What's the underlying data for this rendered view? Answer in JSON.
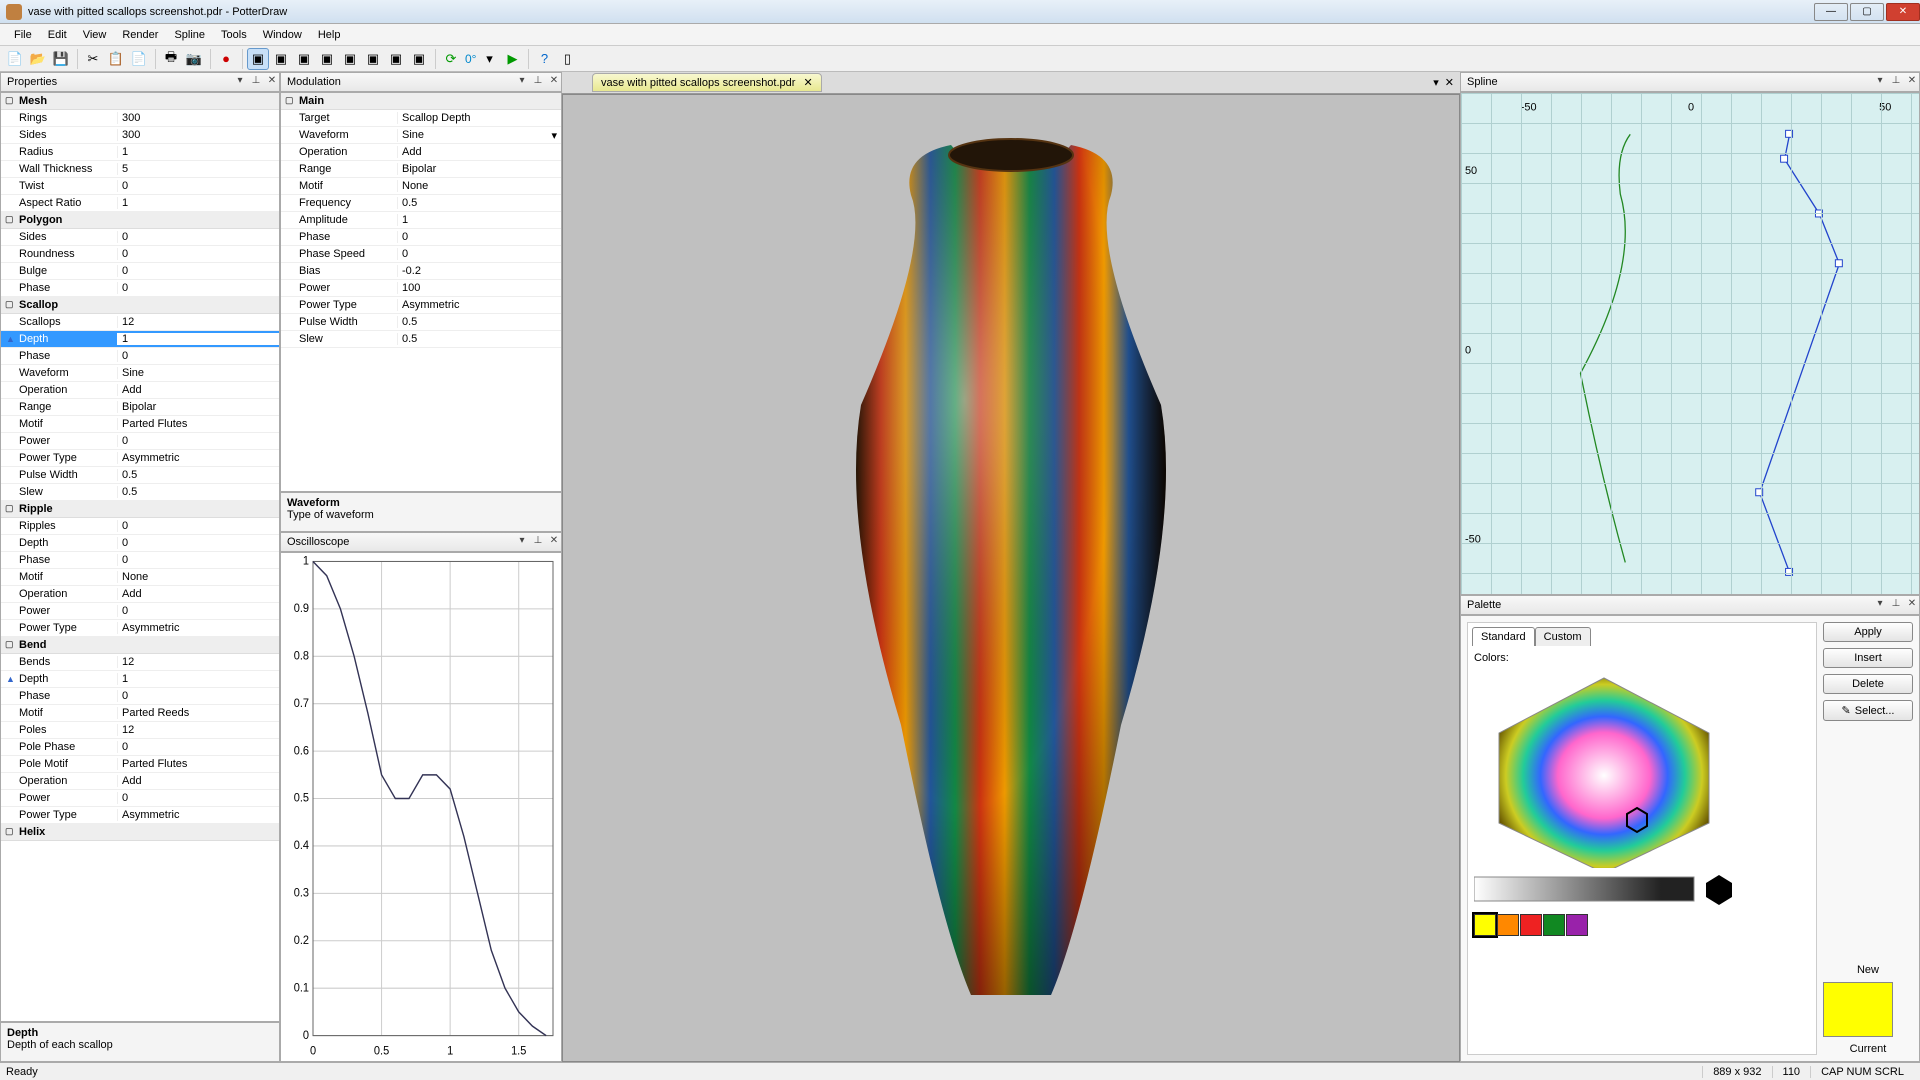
{
  "window": {
    "title": "vase with pitted scallops screenshot.pdr - PotterDraw"
  },
  "menu": [
    "File",
    "Edit",
    "View",
    "Render",
    "Spline",
    "Tools",
    "Window",
    "Help"
  ],
  "toolbar": {
    "degree": "0°"
  },
  "doc_tab": {
    "label": "vase with pitted scallops screenshot.pdr"
  },
  "panels": {
    "properties": "Properties",
    "modulation": "Modulation",
    "oscilloscope": "Oscilloscope",
    "spline": "Spline",
    "palette": "Palette"
  },
  "properties": {
    "help": {
      "title": "Depth",
      "desc": "Depth of each scallop"
    },
    "groups": [
      {
        "name": "Mesh",
        "rows": [
          {
            "n": "Rings",
            "v": "300"
          },
          {
            "n": "Sides",
            "v": "300"
          },
          {
            "n": "Radius",
            "v": "1"
          },
          {
            "n": "Wall Thickness",
            "v": "5"
          },
          {
            "n": "Twist",
            "v": "0"
          },
          {
            "n": "Aspect Ratio",
            "v": "1"
          }
        ]
      },
      {
        "name": "Polygon",
        "rows": [
          {
            "n": "Sides",
            "v": "0"
          },
          {
            "n": "Roundness",
            "v": "0"
          },
          {
            "n": "Bulge",
            "v": "0"
          },
          {
            "n": "Phase",
            "v": "0"
          }
        ]
      },
      {
        "name": "Scallop",
        "rows": [
          {
            "n": "Scallops",
            "v": "12"
          },
          {
            "n": "Depth",
            "v": "1",
            "selected": true,
            "mark": true
          },
          {
            "n": "Phase",
            "v": "0"
          },
          {
            "n": "Waveform",
            "v": "Sine"
          },
          {
            "n": "Operation",
            "v": "Add"
          },
          {
            "n": "Range",
            "v": "Bipolar"
          },
          {
            "n": "Motif",
            "v": "Parted Flutes"
          },
          {
            "n": "Power",
            "v": "0"
          },
          {
            "n": "Power Type",
            "v": "Asymmetric"
          },
          {
            "n": "Pulse Width",
            "v": "0.5"
          },
          {
            "n": "Slew",
            "v": "0.5"
          }
        ]
      },
      {
        "name": "Ripple",
        "rows": [
          {
            "n": "Ripples",
            "v": "0"
          },
          {
            "n": "Depth",
            "v": "0"
          },
          {
            "n": "Phase",
            "v": "0"
          },
          {
            "n": "Motif",
            "v": "None"
          },
          {
            "n": "Operation",
            "v": "Add"
          },
          {
            "n": "Power",
            "v": "0"
          },
          {
            "n": "Power Type",
            "v": "Asymmetric"
          }
        ]
      },
      {
        "name": "Bend",
        "rows": [
          {
            "n": "Bends",
            "v": "12"
          },
          {
            "n": "Depth",
            "v": "1",
            "mark": true
          },
          {
            "n": "Phase",
            "v": "0"
          },
          {
            "n": "Motif",
            "v": "Parted Reeds"
          },
          {
            "n": "Poles",
            "v": "12"
          },
          {
            "n": "Pole Phase",
            "v": "0"
          },
          {
            "n": "Pole Motif",
            "v": "Parted Flutes"
          },
          {
            "n": "Operation",
            "v": "Add"
          },
          {
            "n": "Power",
            "v": "0"
          },
          {
            "n": "Power Type",
            "v": "Asymmetric"
          }
        ]
      },
      {
        "name": "Helix",
        "rows": []
      }
    ]
  },
  "modulation": {
    "help": {
      "title": "Waveform",
      "desc": "Type of waveform"
    },
    "group": "Main",
    "rows": [
      {
        "n": "Target",
        "v": "Scallop Depth"
      },
      {
        "n": "Waveform",
        "v": "Sine",
        "dropdown": true
      },
      {
        "n": "Operation",
        "v": "Add"
      },
      {
        "n": "Range",
        "v": "Bipolar"
      },
      {
        "n": "Motif",
        "v": "None"
      },
      {
        "n": "Frequency",
        "v": "0.5"
      },
      {
        "n": "Amplitude",
        "v": "1"
      },
      {
        "n": "Phase",
        "v": "0"
      },
      {
        "n": "Phase Speed",
        "v": "0"
      },
      {
        "n": "Bias",
        "v": "-0.2"
      },
      {
        "n": "Power",
        "v": "100"
      },
      {
        "n": "Power Type",
        "v": "Asymmetric"
      },
      {
        "n": "Pulse Width",
        "v": "0.5"
      },
      {
        "n": "Slew",
        "v": "0.5"
      }
    ]
  },
  "spline_axis": {
    "xticks": [
      "-50",
      "0",
      "50"
    ],
    "yticks": [
      "50",
      "0",
      "-50"
    ]
  },
  "palette": {
    "tabs": [
      "Standard",
      "Custom"
    ],
    "colors_label": "Colors:",
    "buttons": [
      "Apply",
      "Insert",
      "Delete",
      "Select..."
    ],
    "new_label": "New",
    "current_label": "Current",
    "new_color": "#ffff00",
    "swatches": [
      "#ffff00",
      "#ff8800",
      "#ee2222",
      "#118822",
      "#9922aa"
    ]
  },
  "status": {
    "ready": "Ready",
    "dims": "889 x 932",
    "num": "110",
    "caps": "CAP  NUM  SCRL"
  },
  "chart_data": {
    "type": "line",
    "title": "Oscilloscope",
    "xlabel": "",
    "ylabel": "",
    "xlim": [
      0,
      1.75
    ],
    "ylim": [
      0,
      1
    ],
    "xticks": [
      0,
      0.5,
      1,
      1.5
    ],
    "yticks": [
      0,
      0.1,
      0.2,
      0.3,
      0.4,
      0.5,
      0.6,
      0.7,
      0.8,
      0.9,
      1
    ],
    "series": [
      {
        "name": "wave",
        "x": [
          0,
          0.1,
          0.2,
          0.3,
          0.4,
          0.5,
          0.6,
          0.7,
          0.8,
          0.9,
          1.0,
          1.1,
          1.2,
          1.3,
          1.4,
          1.5,
          1.6,
          1.7
        ],
        "y": [
          1.0,
          0.97,
          0.9,
          0.8,
          0.68,
          0.55,
          0.5,
          0.5,
          0.55,
          0.55,
          0.52,
          0.42,
          0.3,
          0.18,
          0.1,
          0.05,
          0.02,
          0.0
        ]
      }
    ]
  }
}
